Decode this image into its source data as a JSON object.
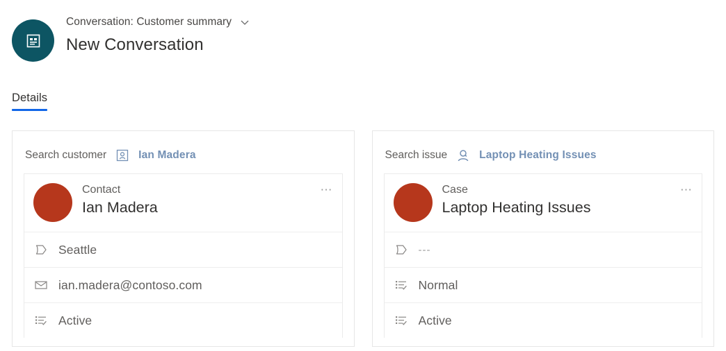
{
  "header": {
    "entity_icon": "conversation-icon",
    "breadcrumb": "Conversation: Customer summary",
    "dropdown_icon": "chevron-down-icon",
    "title": "New Conversation",
    "avatar_color": "#0d5563"
  },
  "tabs": [
    {
      "label": "Details",
      "active": true
    }
  ],
  "accent": {
    "tab_underline": "#1267e8",
    "link": "#7390b4",
    "record_avatar": "#b6371c"
  },
  "cards": [
    {
      "search_label": "Search customer",
      "search_icon": "contact-card-icon",
      "search_value": "Ian Madera",
      "record": {
        "type": "Contact",
        "name": "Ian Madera",
        "more_icon": "more-options-icon",
        "fields": [
          {
            "icon": "tag-icon",
            "value": "Seattle",
            "muted": false
          },
          {
            "icon": "envelope-icon",
            "value": "ian.madera@contoso.com",
            "muted": false
          },
          {
            "icon": "status-list-icon",
            "value": "Active",
            "muted": false
          }
        ]
      }
    },
    {
      "search_label": "Search issue",
      "search_icon": "case-person-icon",
      "search_value": "Laptop Heating Issues",
      "record": {
        "type": "Case",
        "name": "Laptop Heating Issues",
        "more_icon": "more-options-icon",
        "fields": [
          {
            "icon": "tag-icon",
            "value": "---",
            "muted": true
          },
          {
            "icon": "status-list-icon",
            "value": "Normal",
            "muted": false
          },
          {
            "icon": "status-list-icon",
            "value": "Active",
            "muted": false
          }
        ]
      }
    }
  ]
}
